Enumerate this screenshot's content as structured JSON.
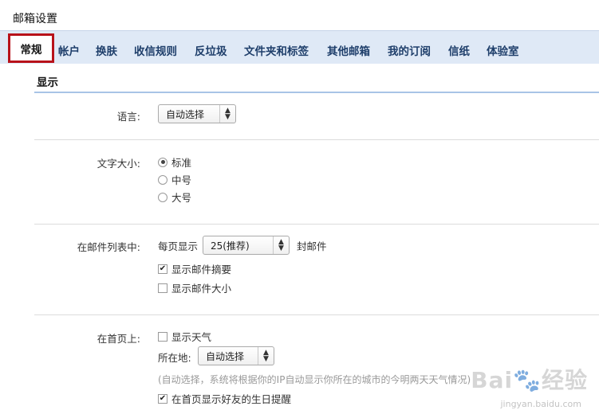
{
  "page": {
    "title": "邮箱设置"
  },
  "tabs": [
    {
      "label": "常规",
      "active": true
    },
    {
      "label": "帐户"
    },
    {
      "label": "换肤"
    },
    {
      "label": "收信规则"
    },
    {
      "label": "反垃圾"
    },
    {
      "label": "文件夹和标签"
    },
    {
      "label": "其他邮箱"
    },
    {
      "label": "我的订阅"
    },
    {
      "label": "信纸"
    },
    {
      "label": "体验室"
    }
  ],
  "section": {
    "title": "显示"
  },
  "language": {
    "label": "语言:",
    "selected": "自动选择"
  },
  "font_size": {
    "label": "文字大小:",
    "options": [
      {
        "label": "标准",
        "checked": true
      },
      {
        "label": "中号",
        "checked": false
      },
      {
        "label": "大号",
        "checked": false
      }
    ]
  },
  "mail_list": {
    "label": "在邮件列表中:",
    "per_page_prefix": "每页显示",
    "per_page_selected": "25(推荐)",
    "per_page_suffix": "封邮件",
    "show_summary": {
      "label": "显示邮件摘要",
      "checked": true
    },
    "show_size": {
      "label": "显示邮件大小",
      "checked": false
    }
  },
  "homepage": {
    "label": "在首页上:",
    "show_weather": {
      "label": "显示天气",
      "checked": false
    },
    "location_label": "所在地:",
    "location_selected": "自动选择",
    "hint": "(自动选择，系统将根据你的IP自动显示你所在的城市的今明两天天气情况)",
    "show_birthday": {
      "label": "在首页显示好友的生日提醒",
      "checked": true
    }
  },
  "watermark": {
    "text": "Bai🐾经验",
    "url": "jingyan.baidu.com"
  }
}
